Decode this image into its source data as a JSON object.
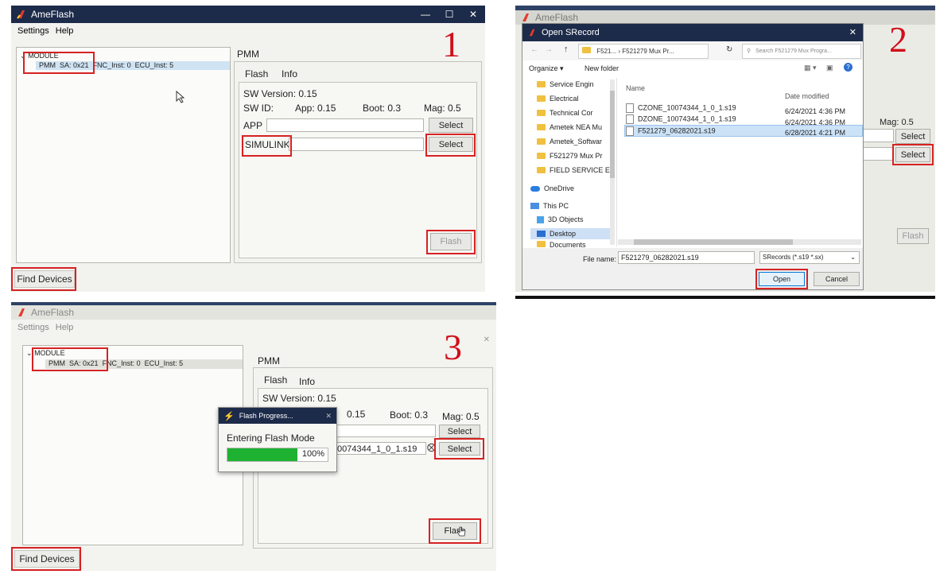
{
  "app_title": "AmeFlash",
  "menu": [
    "Settings",
    "Help"
  ],
  "tree": {
    "root": "MODULE",
    "item_name": "PMM",
    "item_sa": "SA: 0x21",
    "item_fnc": "FNC_Inst: 0",
    "item_ecu": "ECU_Inst: 5"
  },
  "pmm_label": "PMM",
  "tabs": [
    "Flash",
    "Info"
  ],
  "sw_version": "SW Version: 0.15",
  "sw_id_label": "SW ID:",
  "app_version": "App: 0.15",
  "boot_version": "Boot: 0.3",
  "mag_version": "Mag: 0.5",
  "app_field_label": "APP",
  "simulink_label": "SIMULINK",
  "select_label": "Select",
  "flash_label": "Flash",
  "find_devices_label": "Find Devices",
  "steps": [
    "1",
    "2",
    "3"
  ],
  "dialog": {
    "title": "Open SRecord",
    "breadcrumb_1": "F521...",
    "breadcrumb_2": "F521279 Mux Pr...",
    "search_placeholder": "Search F521279 Mux Progra...",
    "organize": "Organize",
    "new_folder": "New folder",
    "col_name": "Name",
    "col_date": "Date modified",
    "nav": [
      "Service Engin",
      "Electrical",
      "Technical Cor",
      "Ametek NEA Mu",
      "Ametek_Softwar",
      "F521279 Mux Pr",
      "FIELD SERVICE E",
      "OneDrive",
      "This PC",
      "3D Objects",
      "Desktop",
      "Documents"
    ],
    "files": [
      {
        "name": "CZONE_10074344_1_0_1.s19",
        "date": "6/24/2021 4:36 PM"
      },
      {
        "name": "DZONE_10074344_1_0_1.s19",
        "date": "6/24/2021 4:36 PM"
      },
      {
        "name": "F521279_06282021.s19",
        "date": "6/28/2021 4:21 PM"
      }
    ],
    "file_name_label": "File name:",
    "file_name_value": "F521279_06282021.s19",
    "file_type": "SRecords (*.s19 *.sx)",
    "open": "Open",
    "cancel": "Cancel"
  },
  "progress": {
    "title": "Flash Progress...",
    "status": "Entering Flash Mode",
    "percent_text": "100%",
    "percent": 100
  },
  "panel3_file_tail": "0074344_1_0_1.s19",
  "panel3_app_version": "0.15"
}
